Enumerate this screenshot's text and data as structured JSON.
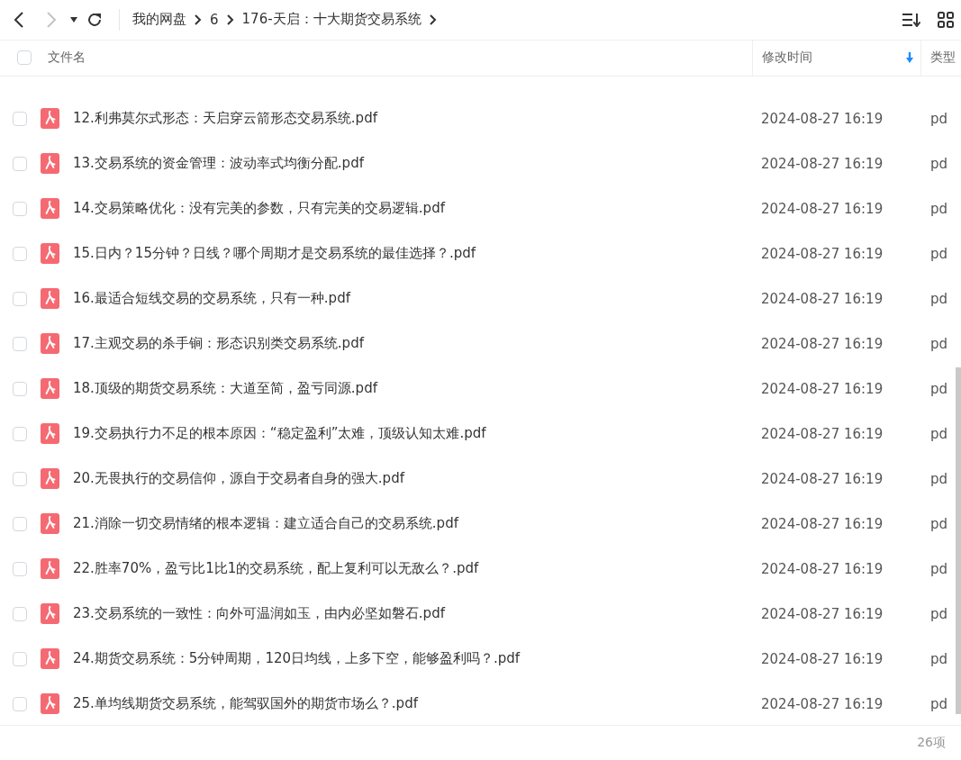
{
  "toolbar": {
    "breadcrumb": [
      "我的网盘",
      "6",
      "176-天启：十大期货交易系统"
    ],
    "back_disabled": false,
    "forward_disabled": true
  },
  "table": {
    "columns": [
      {
        "label": "文件名",
        "sorted": false
      },
      {
        "label": "修改时间",
        "sorted": true
      },
      {
        "label": "类型",
        "sorted": false
      }
    ],
    "header_checked": false,
    "rows": [
      {
        "name": "12.利弗莫尔式形态：天启穿云箭形态交易系统.pdf",
        "modified": "2024-08-27 16:19",
        "type": "pd",
        "checked": false
      },
      {
        "name": "13.交易系统的资金管理：波动率式均衡分配.pdf",
        "modified": "2024-08-27 16:19",
        "type": "pd",
        "checked": false
      },
      {
        "name": "14.交易策略优化：没有完美的参数，只有完美的交易逻辑.pdf",
        "modified": "2024-08-27 16:19",
        "type": "pd",
        "checked": false
      },
      {
        "name": "15.日内？15分钟？日线？哪个周期才是交易系统的最佳选择？.pdf",
        "modified": "2024-08-27 16:19",
        "type": "pd",
        "checked": false
      },
      {
        "name": "16.最适合短线交易的交易系统，只有一种.pdf",
        "modified": "2024-08-27 16:19",
        "type": "pd",
        "checked": false
      },
      {
        "name": "17.主观交易的杀手锏：形态识别类交易系统.pdf",
        "modified": "2024-08-27 16:19",
        "type": "pd",
        "checked": false
      },
      {
        "name": "18.顶级的期货交易系统：大道至简，盈亏同源.pdf",
        "modified": "2024-08-27 16:19",
        "type": "pd",
        "checked": false
      },
      {
        "name": "19.交易执行力不足的根本原因：“稳定盈利”太难，顶级认知太难.pdf",
        "modified": "2024-08-27 16:19",
        "type": "pd",
        "checked": false
      },
      {
        "name": "20.无畏执行的交易信仰，源自于交易者自身的强大.pdf",
        "modified": "2024-08-27 16:19",
        "type": "pd",
        "checked": false
      },
      {
        "name": "21.消除一切交易情绪的根本逻辑：建立适合自己的交易系统.pdf",
        "modified": "2024-08-27 16:19",
        "type": "pd",
        "checked": false
      },
      {
        "name": "22.胜率70%，盈亏比1比1的交易系统，配上复利可以无敌么？.pdf",
        "modified": "2024-08-27 16:19",
        "type": "pd",
        "checked": false
      },
      {
        "name": "23.交易系统的一致性：向外可温润如玉，由内必坚如磐石.pdf",
        "modified": "2024-08-27 16:19",
        "type": "pd",
        "checked": false
      },
      {
        "name": "24.期货交易系统：5分钟周期，120日均线，上多下空，能够盈利吗？.pdf",
        "modified": "2024-08-27 16:19",
        "type": "pd",
        "checked": false
      },
      {
        "name": "25.单均线期货交易系统，能驾驭国外的期货市场么？.pdf",
        "modified": "2024-08-27 16:19",
        "type": "pd",
        "checked": false
      }
    ]
  },
  "status_bar": {
    "count": "26项"
  }
}
